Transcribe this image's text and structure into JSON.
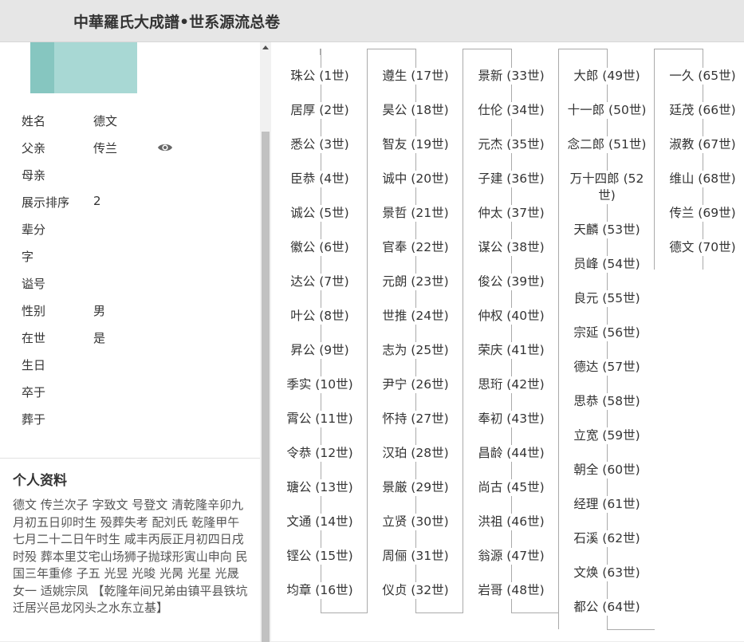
{
  "header": {
    "title": "中華羅氏大成譜•世系源流总卷"
  },
  "profile": {
    "fields": [
      {
        "label": "姓名",
        "value": "德文"
      },
      {
        "label": "父亲",
        "value": "传兰"
      },
      {
        "label": "母亲",
        "value": ""
      },
      {
        "label": "展示排序",
        "value": "2"
      },
      {
        "label": "辈分",
        "value": ""
      },
      {
        "label": "字",
        "value": ""
      },
      {
        "label": "谥号",
        "value": ""
      },
      {
        "label": "性别",
        "value": "男"
      },
      {
        "label": "在世",
        "value": "是"
      },
      {
        "label": "生日",
        "value": ""
      },
      {
        "label": "卒于",
        "value": ""
      },
      {
        "label": "葬于",
        "value": ""
      }
    ],
    "eye_icon": "eye-icon"
  },
  "bio": {
    "title": "个人资料",
    "text": "德文 传兰次子 字致文 号登文 清乾隆辛卯九月初五日卯时生 殁葬失考 配刘氏 乾隆甲午七月二十二日午时生 咸丰丙辰正月初四日戌时殁 葬本里艾宅山场狮子抛球形寅山申向 民国三年重修 子五 光昱 光晙 光昺 光星 光晟 女一 适姚宗凤 【乾隆年间兄弟由镇平县铁坑迁居兴邑龙冈头之水东立基】"
  },
  "tree": {
    "columns": [
      [
        "珠公 (1世)",
        "居厚 (2世)",
        "悉公 (3世)",
        "臣恭 (4世)",
        "诚公 (5世)",
        "徽公 (6世)",
        "达公 (7世)",
        "叶公 (8世)",
        "昇公 (9世)",
        "季实 (10世)",
        "霄公 (11世)",
        "令恭 (12世)",
        "瑭公 (13世)",
        "文通 (14世)",
        "铿公 (15世)",
        "均章 (16世)"
      ],
      [
        "遵生 (17世)",
        "昊公 (18世)",
        "智友 (19世)",
        "诚中 (20世)",
        "景哲 (21世)",
        "官奉 (22世)",
        "元朗 (23世)",
        "世推 (24世)",
        "志为 (25世)",
        "尹宁 (26世)",
        "怀持 (27世)",
        "汉珀 (28世)",
        "景厳 (29世)",
        "立贤 (30世)",
        "周俪 (31世)",
        "仪贞 (32世)"
      ],
      [
        "景新 (33世)",
        "仕伦 (34世)",
        "元杰 (35世)",
        "子建 (36世)",
        "仲太 (37世)",
        "谋公 (38世)",
        "俊公 (39世)",
        "仲权 (40世)",
        "荣庆 (41世)",
        "思珩 (42世)",
        "奉初 (43世)",
        "昌龄 (44世)",
        "尚古 (45世)",
        "洪祖 (46世)",
        "翁源 (47世)",
        "岩哥 (48世)"
      ],
      [
        "大郎 (49世)",
        "十一郎 (50世)",
        "念二郎 (51世)",
        "万十四郎 (52世)",
        "天麟 (53世)",
        "员峰 (54世)",
        "良元 (55世)",
        "宗延 (56世)",
        "德达 (57世)",
        "思恭 (58世)",
        "立宽 (59世)",
        "朝全 (60世)",
        "经理 (61世)",
        "石溪 (62世)",
        "文焕 (63世)",
        "都公 (64世)"
      ],
      [
        "一久 (65世)",
        "廷茂 (66世)",
        "淑教 (67世)",
        "维山 (68世)",
        "传兰 (69世)",
        "德文 (70世)"
      ]
    ]
  }
}
